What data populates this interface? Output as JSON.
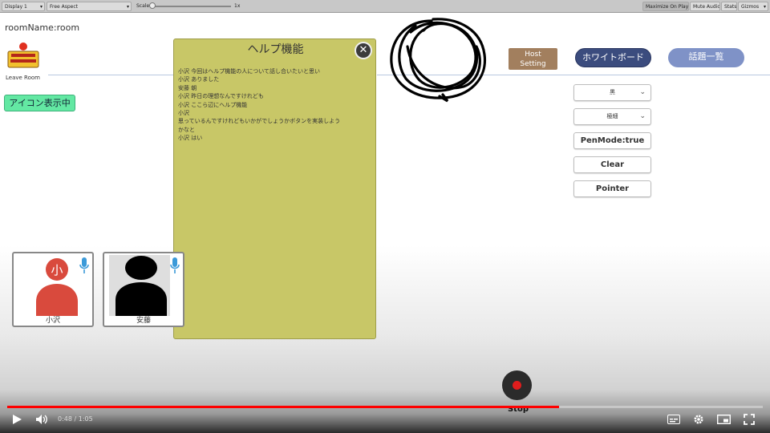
{
  "unity_toolbar": {
    "display": "Display 1",
    "aspect": "Free Aspect",
    "scale_label": "Scale",
    "scale_value": "1x",
    "maximize": "Maximize On Play",
    "mute": "Mute Audio",
    "stats": "Stats",
    "gizmos": "Gizmos"
  },
  "room": {
    "name": "roomName:room",
    "leave": "Leave Room"
  },
  "icon_toggle": "アイコン表示中",
  "help": {
    "title": "ヘルプ機能",
    "lines": [
      "小沢 今回はヘルプ機能の人について話し合いたいと思い",
      "小沢 ありました",
      "安藤 朝",
      "小沢 昨日の理想なんですけれども",
      "小沢 ここら辺にヘルプ機能",
      "小沢",
      "思っているんですけれどもいかがでしょうかボタンを実装しよう",
      "かなと",
      "小沢 はい"
    ]
  },
  "header_buttons": {
    "host": "Host\nSetting",
    "whiteboard": "ホワイトボード",
    "topics": "話題一覧"
  },
  "tools": {
    "color": "黒",
    "width": "極細",
    "penmode": "PenMode:true",
    "clear": "Clear",
    "pointer": "Pointer"
  },
  "participants": [
    {
      "name": "小沢",
      "initial": "小",
      "avatar_color": "#d94a3d"
    },
    {
      "name": "安藤",
      "initial": "",
      "avatar_color": "#000000"
    }
  ],
  "stop_label": "Stop",
  "player": {
    "time": "0:48 / 1:05",
    "progress": 0.73
  },
  "colors": {
    "accent_red": "#ff0000",
    "help_panel": "#c8c767",
    "toggle_green": "#63e8a3"
  }
}
